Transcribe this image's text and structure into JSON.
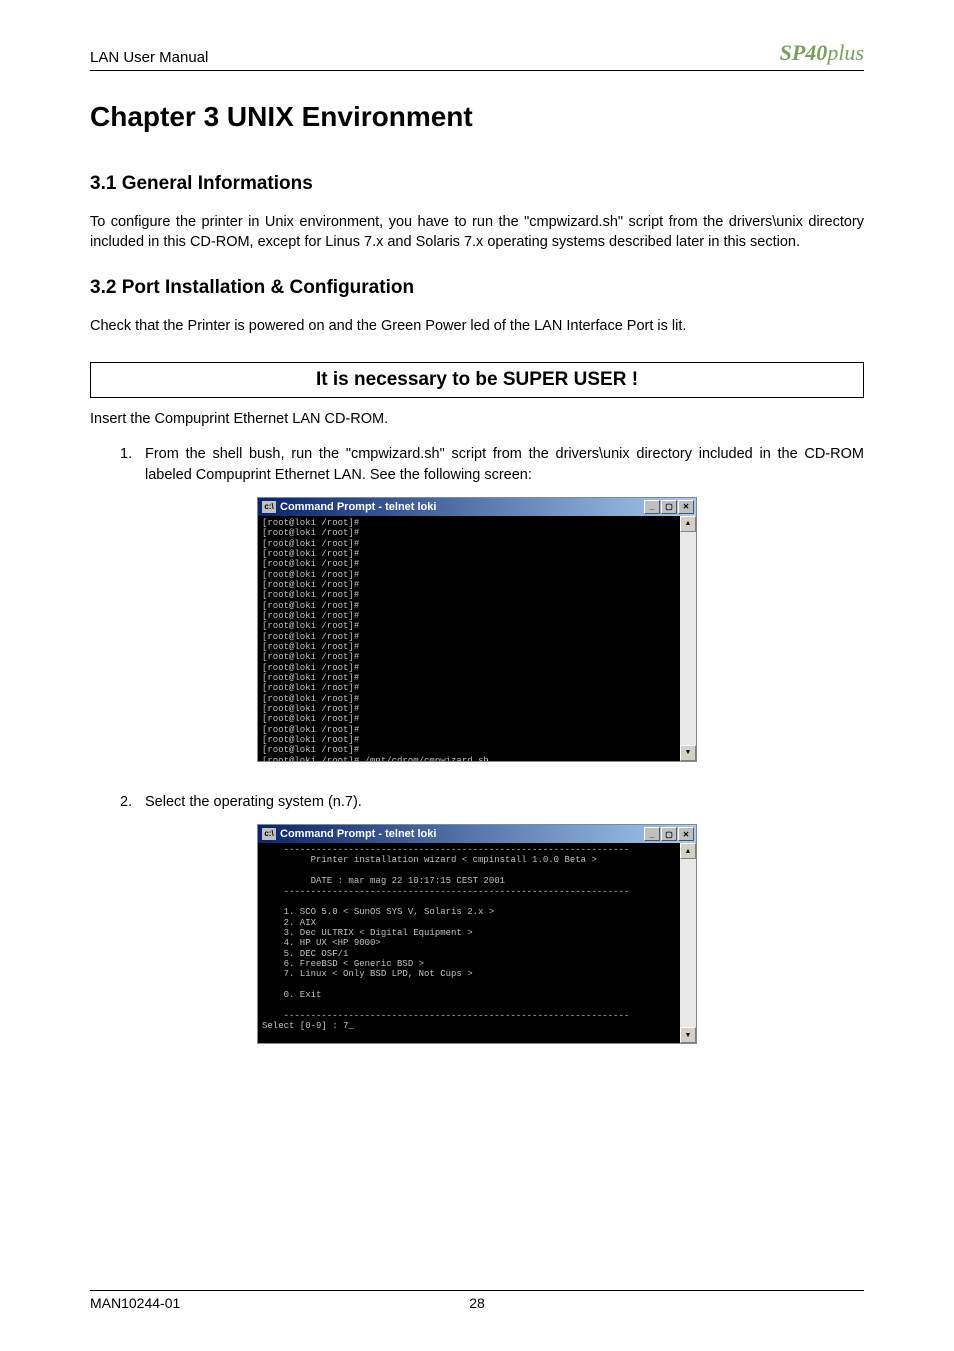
{
  "header": {
    "title": "LAN User Manual",
    "logo_main": "SP40",
    "logo_suffix": "plus"
  },
  "chapter": {
    "title": "Chapter 3  UNIX Environment"
  },
  "section1": {
    "title": "3.1 General Informations",
    "body": "To configure the printer in Unix environment, you have to run the   \"cmpwizard.sh\"   script   from   the drivers\\unix   directory included in this CD-ROM, except for Linus 7.x and Solaris 7.x operating systems described later in this section."
  },
  "section2": {
    "title": "3.2  Port Installation & Configuration",
    "intro": "Check that the Printer is powered on and the Green Power led of the LAN Interface Port is lit.",
    "notice": "It is necessary to be SUPER USER !",
    "insert": "Insert the Compuprint Ethernet LAN CD-ROM.",
    "step1_num": "1.",
    "step1": "From the shell bush, run the \"cmpwizard.sh\" script from the  drivers\\unix  directory  included  in  the CD-ROM labeled  Compuprint  Ethernet  LAN.  See  the  following screen:",
    "step2_num": "2.",
    "step2": "Select the operating system (n.7)."
  },
  "terminal1": {
    "title": "Command Prompt - telnet loki",
    "content": "[root@loki /root]#\n[root@loki /root]#\n[root@loki /root]#\n[root@loki /root]#\n[root@loki /root]#\n[root@loki /root]#\n[root@loki /root]#\n[root@loki /root]#\n[root@loki /root]#\n[root@loki /root]#\n[root@loki /root]#\n[root@loki /root]#\n[root@loki /root]#\n[root@loki /root]#\n[root@loki /root]#\n[root@loki /root]#\n[root@loki /root]#\n[root@loki /root]#\n[root@loki /root]#\n[root@loki /root]#\n[root@loki /root]#\n[root@loki /root]#\n[root@loki /root]#\n[root@loki /root]# /mnt/cdrom/cmpwizard.sh"
  },
  "terminal2": {
    "title": "Command Prompt - telnet loki",
    "content": "    ----------------------------------------------------------------\n         Printer installation wizard < cmpinstall 1.0.0 Beta >\n\n         DATE : mar mag 22 10:17:15 CEST 2001\n    ----------------------------------------------------------------\n\n    1. SCO 5.0 < SunOS SYS V, Solaris 2.x >\n    2. AIX\n    3. Dec ULTRIX < Digital Equipment >\n    4. HP UX <HP 9000>\n    5. DEC OSF/1\n    6. FreeBSD < Generic BSD >\n    7. Linux < Only BSD LPD, Not Cups >\n\n    0. Exit\n\n    ----------------------------------------------------------------\nSelect [0-9] : 7_"
  },
  "footer": {
    "left": "MAN10244-01",
    "page": "28"
  },
  "icons": {
    "min": "_",
    "max": "▢",
    "close": "✕",
    "up": "▲",
    "down": "▼"
  }
}
